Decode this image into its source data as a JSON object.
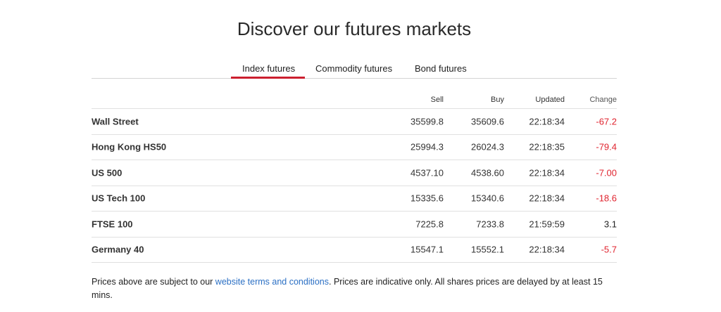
{
  "page_title": "Discover our futures markets",
  "tabs": [
    {
      "label": "Index futures",
      "active": true
    },
    {
      "label": "Commodity futures",
      "active": false
    },
    {
      "label": "Bond futures",
      "active": false
    }
  ],
  "table": {
    "headers": {
      "sell": "Sell",
      "buy": "Buy",
      "updated": "Updated",
      "change": "Change"
    },
    "rows": [
      {
        "name": "Wall Street",
        "sell": "35599.8",
        "buy": "35609.6",
        "updated": "22:18:34",
        "change": "-67.2",
        "negative": true
      },
      {
        "name": "Hong Kong HS50",
        "sell": "25994.3",
        "buy": "26024.3",
        "updated": "22:18:35",
        "change": "-79.4",
        "negative": true
      },
      {
        "name": "US 500",
        "sell": "4537.10",
        "buy": "4538.60",
        "updated": "22:18:34",
        "change": "-7.00",
        "negative": true
      },
      {
        "name": "US Tech 100",
        "sell": "15335.6",
        "buy": "15340.6",
        "updated": "22:18:34",
        "change": "-18.6",
        "negative": true
      },
      {
        "name": "FTSE 100",
        "sell": "7225.8",
        "buy": "7233.8",
        "updated": "21:59:59",
        "change": "3.1",
        "negative": false
      },
      {
        "name": "Germany 40",
        "sell": "15547.1",
        "buy": "15552.1",
        "updated": "22:18:34",
        "change": "-5.7",
        "negative": true
      }
    ]
  },
  "footer": {
    "prefix": "Prices above are subject to our ",
    "link_text": "website terms and conditions",
    "suffix": ". Prices are indicative only. All shares prices are delayed by at least 15 mins."
  },
  "colors": {
    "accent": "#cc1f2f",
    "negative": "#e0242f",
    "link": "#2a6fc4"
  }
}
